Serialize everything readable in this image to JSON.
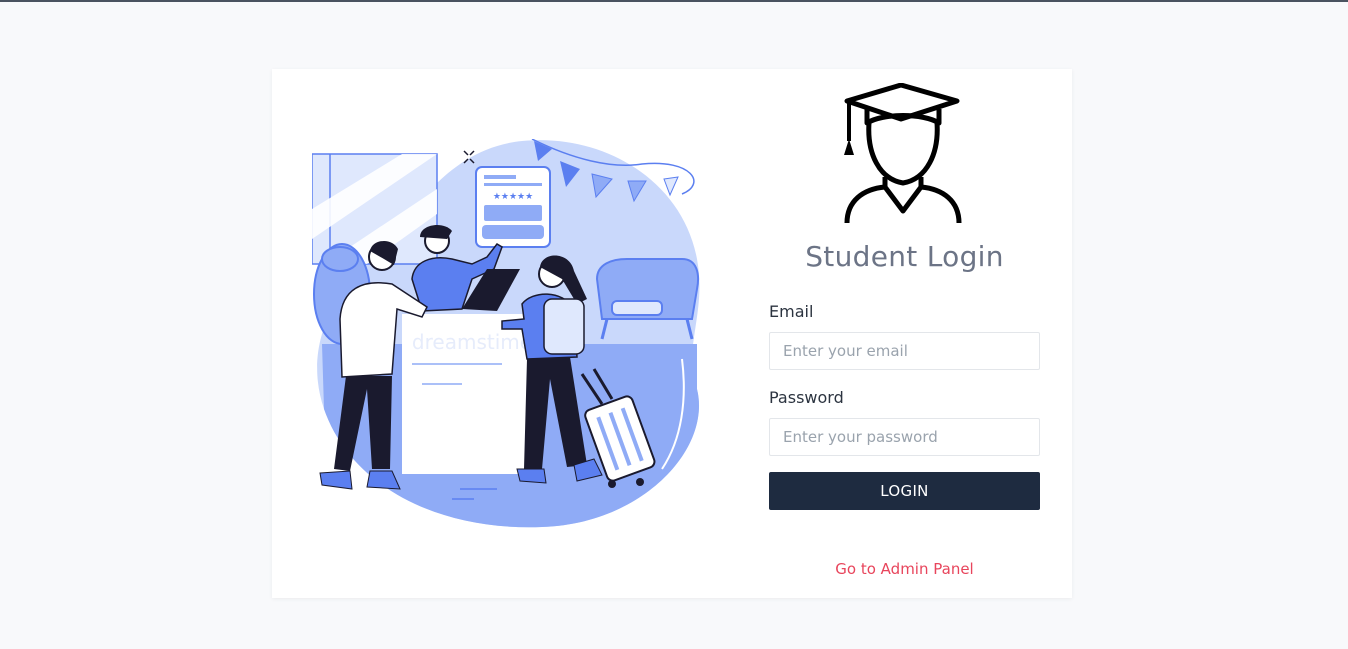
{
  "page": {
    "title": "Student Login"
  },
  "illustration": {
    "watermark": "dreamstime",
    "rating": "★★★★★"
  },
  "form": {
    "email_label": "Email",
    "email_placeholder": "Enter your email",
    "password_label": "Password",
    "password_placeholder": "Enter your password",
    "login_label": "LOGIN"
  },
  "footer": {
    "admin_link": "Go to Admin Panel"
  },
  "colors": {
    "topbar": "#4a5360",
    "button": "#1e2b40",
    "link": "#e8455c",
    "illustration_accent": "#5b7ff0"
  },
  "icons": {
    "avatar": "graduate-icon"
  }
}
